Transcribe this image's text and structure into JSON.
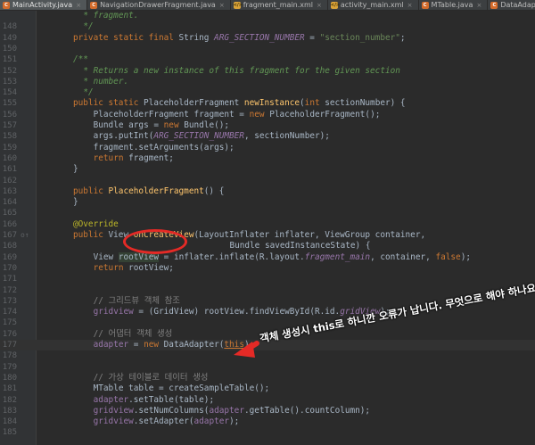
{
  "tabs": [
    {
      "label": "MainActivity.java",
      "type": "java",
      "active": true
    },
    {
      "label": "NavigationDrawerFragment.java",
      "type": "java",
      "active": false
    },
    {
      "label": "fragment_main.xml",
      "type": "xml",
      "active": false
    },
    {
      "label": "activity_main.xml",
      "type": "xml",
      "active": false
    },
    {
      "label": "MTable.java",
      "type": "java",
      "active": false
    },
    {
      "label": "DataAdapter.java",
      "type": "java",
      "active": false
    }
  ],
  "file_icon_letters": {
    "java": "C",
    "xml": "&lt;/&gt;"
  },
  "close_glyph": "×",
  "lines": [
    {
      "n": "",
      "segs": [
        {
          "c": "cm",
          "t": "* fragment."
        }
      ],
      "ind": 2
    },
    {
      "n": "148",
      "segs": [
        {
          "c": "cm",
          "t": "*/"
        }
      ],
      "ind": 2
    },
    {
      "n": "149",
      "segs": [
        {
          "c": "kw",
          "t": "private static final "
        },
        {
          "c": "",
          "t": "String "
        },
        {
          "c": "sf",
          "t": "ARG_SECTION_NUMBER"
        },
        {
          "c": "",
          "t": " = "
        },
        {
          "c": "st",
          "t": "\"section_number\""
        },
        {
          "c": "",
          "t": ";"
        }
      ],
      "ind": 0
    },
    {
      "n": "150",
      "segs": [],
      "ind": 0
    },
    {
      "n": "151",
      "segs": [
        {
          "c": "cm",
          "t": "/**"
        }
      ],
      "ind": 0
    },
    {
      "n": "152",
      "segs": [
        {
          "c": "cm",
          "t": "* Returns a new instance of this fragment for the given section"
        }
      ],
      "ind": 2
    },
    {
      "n": "153",
      "segs": [
        {
          "c": "cm",
          "t": "* number."
        }
      ],
      "ind": 2
    },
    {
      "n": "154",
      "segs": [
        {
          "c": "cm",
          "t": "*/"
        }
      ],
      "ind": 2
    },
    {
      "n": "155",
      "segs": [
        {
          "c": "kw",
          "t": "public static "
        },
        {
          "c": "",
          "t": "PlaceholderFragment "
        },
        {
          "c": "fn",
          "t": "newInstance"
        },
        {
          "c": "",
          "t": "("
        },
        {
          "c": "kw",
          "t": "int "
        },
        {
          "c": "",
          "t": "sectionNumber) {"
        }
      ],
      "ind": 0
    },
    {
      "n": "156",
      "segs": [
        {
          "c": "",
          "t": "PlaceholderFragment fragment = "
        },
        {
          "c": "kw",
          "t": "new "
        },
        {
          "c": "",
          "t": "PlaceholderFragment();"
        }
      ],
      "ind": 4
    },
    {
      "n": "157",
      "segs": [
        {
          "c": "",
          "t": "Bundle args = "
        },
        {
          "c": "kw",
          "t": "new "
        },
        {
          "c": "",
          "t": "Bundle();"
        }
      ],
      "ind": 4
    },
    {
      "n": "158",
      "segs": [
        {
          "c": "",
          "t": "args.putInt("
        },
        {
          "c": "sf",
          "t": "ARG_SECTION_NUMBER"
        },
        {
          "c": "",
          "t": ", sectionNumber);"
        }
      ],
      "ind": 4
    },
    {
      "n": "159",
      "segs": [
        {
          "c": "",
          "t": "fragment.setArguments(args);"
        }
      ],
      "ind": 4
    },
    {
      "n": "160",
      "segs": [
        {
          "c": "kw",
          "t": "return "
        },
        {
          "c": "",
          "t": "fragment;"
        }
      ],
      "ind": 4
    },
    {
      "n": "161",
      "segs": [
        {
          "c": "",
          "t": "}"
        }
      ],
      "ind": 0
    },
    {
      "n": "162",
      "segs": [],
      "ind": 0
    },
    {
      "n": "163",
      "segs": [
        {
          "c": "kw",
          "t": "public "
        },
        {
          "c": "fn",
          "t": "PlaceholderFragment"
        },
        {
          "c": "",
          "t": "() {"
        }
      ],
      "ind": 0
    },
    {
      "n": "164",
      "segs": [
        {
          "c": "",
          "t": "}"
        }
      ],
      "ind": 0
    },
    {
      "n": "165",
      "segs": [],
      "ind": 0
    },
    {
      "n": "166",
      "segs": [
        {
          "c": "an",
          "t": "@Override"
        }
      ],
      "ind": 0
    },
    {
      "n": "167",
      "segs": [
        {
          "c": "kw",
          "t": "public "
        },
        {
          "c": "",
          "t": "View "
        },
        {
          "c": "fn",
          "t": "onCreateView"
        },
        {
          "c": "",
          "t": "(LayoutInflater inflater, ViewGroup container,"
        }
      ],
      "ind": 0,
      "mark": "o↑"
    },
    {
      "n": "168",
      "segs": [
        {
          "c": "",
          "t": "Bundle savedInstanceState) {"
        }
      ],
      "ind": 31
    },
    {
      "n": "169",
      "segs": [
        {
          "c": "",
          "t": "View "
        },
        {
          "c": "vhl",
          "t": "rootView"
        },
        {
          "c": "",
          "t": " = inflater.inflate(R.layout."
        },
        {
          "c": "sf",
          "t": "fragment_main"
        },
        {
          "c": "",
          "t": ", container, "
        },
        {
          "c": "kw",
          "t": "false"
        },
        {
          "c": "",
          "t": ");"
        }
      ],
      "ind": 4
    },
    {
      "n": "170",
      "segs": [
        {
          "c": "kw",
          "t": "return "
        },
        {
          "c": "",
          "t": "rootView;"
        }
      ],
      "ind": 4
    },
    {
      "n": "171",
      "segs": [],
      "ind": 0
    },
    {
      "n": "172",
      "segs": [],
      "ind": 0
    },
    {
      "n": "173",
      "segs": [
        {
          "c": "lc",
          "t": "// 그리드뷰 객체 참조"
        }
      ],
      "ind": 4
    },
    {
      "n": "174",
      "segs": [
        {
          "c": "fi",
          "t": "gridview"
        },
        {
          "c": "",
          "t": " = (GridView) rootView.findViewById(R.id."
        },
        {
          "c": "sf",
          "t": "gridView"
        },
        {
          "c": "",
          "t": ");"
        }
      ],
      "ind": 4
    },
    {
      "n": "175",
      "segs": [],
      "ind": 0
    },
    {
      "n": "176",
      "segs": [
        {
          "c": "lc",
          "t": "// 어댑터 객체 생성"
        }
      ],
      "ind": 4
    },
    {
      "n": "177",
      "segs": [
        {
          "c": "fi",
          "t": "adapter"
        },
        {
          "c": "",
          "t": " = "
        },
        {
          "c": "kw",
          "t": "new "
        },
        {
          "c": "",
          "t": "DataAdapter("
        },
        {
          "c": "kw under",
          "t": "this"
        },
        {
          "c": "",
          "t": ");"
        }
      ],
      "ind": 4,
      "hl": true
    },
    {
      "n": "178",
      "segs": [],
      "ind": 0
    },
    {
      "n": "179",
      "segs": [],
      "ind": 0
    },
    {
      "n": "180",
      "segs": [
        {
          "c": "lc",
          "t": "// 가상 테이블로 데이터 생성"
        }
      ],
      "ind": 4
    },
    {
      "n": "181",
      "segs": [
        {
          "c": "",
          "t": "MTable table = createSampleTable();"
        }
      ],
      "ind": 4
    },
    {
      "n": "182",
      "segs": [
        {
          "c": "fi",
          "t": "adapter"
        },
        {
          "c": "",
          "t": ".setTable(table);"
        }
      ],
      "ind": 4
    },
    {
      "n": "183",
      "segs": [
        {
          "c": "fi",
          "t": "gridview"
        },
        {
          "c": "",
          "t": ".setNumColumns("
        },
        {
          "c": "fi",
          "t": "adapter"
        },
        {
          "c": "",
          "t": ".getTable().countColumn);"
        }
      ],
      "ind": 4
    },
    {
      "n": "184",
      "segs": [
        {
          "c": "fi",
          "t": "gridview"
        },
        {
          "c": "",
          "t": ".setAdapter("
        },
        {
          "c": "fi",
          "t": "adapter"
        },
        {
          "c": "",
          "t": ");"
        }
      ],
      "ind": 4
    },
    {
      "n": "185",
      "segs": [],
      "ind": 0
    }
  ],
  "annotation": {
    "text": "객체 생성시 this로 하니깐 오류가 납니다. 무엇으로 해야 하나요?",
    "color": "#e52a26"
  }
}
